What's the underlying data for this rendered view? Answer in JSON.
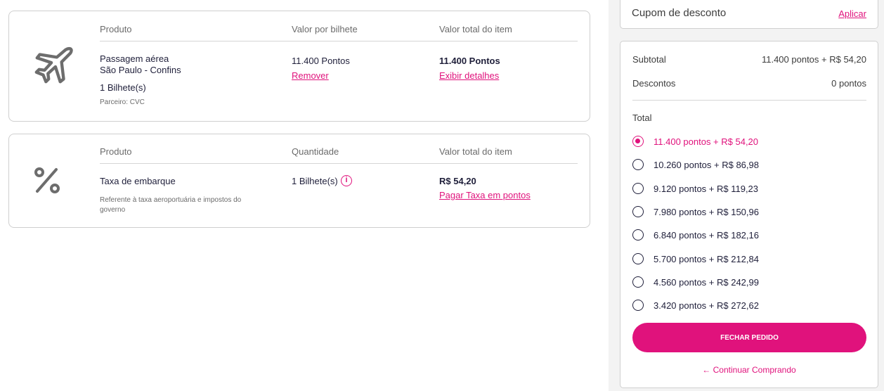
{
  "flight_item": {
    "col_product": "Produto",
    "col_unit_value": "Valor por bilhete",
    "col_total": "Valor total do item",
    "product_line1": "Passagem aérea",
    "product_line2": "São Paulo - Confins",
    "tickets": "1 Bilhete(s)",
    "partner": "Parceiro: CVC",
    "unit_value": "11.400 Pontos",
    "remove_link": "Remover",
    "total_value": "11.400 Pontos",
    "details_link": "Exibir detalhes",
    "icon": "airplane-icon"
  },
  "tax_item": {
    "col_product": "Produto",
    "col_quantity": "Quantidade",
    "col_total": "Valor total do item",
    "product_name": "Taxa de embarque",
    "description": "Referente à taxa aeroportuária e impostos do governo",
    "quantity": "1 Bilhete(s)",
    "info_glyph": "i",
    "total_value": "R$ 54,20",
    "pay_points_link": "Pagar Taxa em pontos",
    "icon": "percent-icon"
  },
  "coupon": {
    "title": "Cupom de desconto",
    "apply_link": "Aplicar"
  },
  "summary": {
    "subtotal_label": "Subtotal",
    "subtotal_value": "11.400 pontos + R$ 54,20",
    "discounts_label": "Descontos",
    "discounts_value": "0 pontos",
    "total_label": "Total",
    "options": [
      {
        "label": "11.400 pontos + R$ 54,20",
        "selected": true
      },
      {
        "label": "10.260 pontos + R$ 86,98",
        "selected": false
      },
      {
        "label": "9.120 pontos + R$ 119,23",
        "selected": false
      },
      {
        "label": "7.980 pontos + R$ 150,96",
        "selected": false
      },
      {
        "label": "6.840 pontos + R$ 182,16",
        "selected": false
      },
      {
        "label": "5.700 pontos + R$ 212,84",
        "selected": false
      },
      {
        "label": "4.560 pontos + R$ 242,99",
        "selected": false
      },
      {
        "label": "3.420 pontos + R$ 272,62",
        "selected": false
      }
    ],
    "checkout_button": "FECHAR PEDIDO",
    "continue_arrow": "←",
    "continue_link": "Continuar Comprando"
  },
  "colors": {
    "accent": "#e0127c",
    "text": "#1f1f3a",
    "border": "#cfcfcf",
    "panel_bg": "#f3f3f3"
  }
}
